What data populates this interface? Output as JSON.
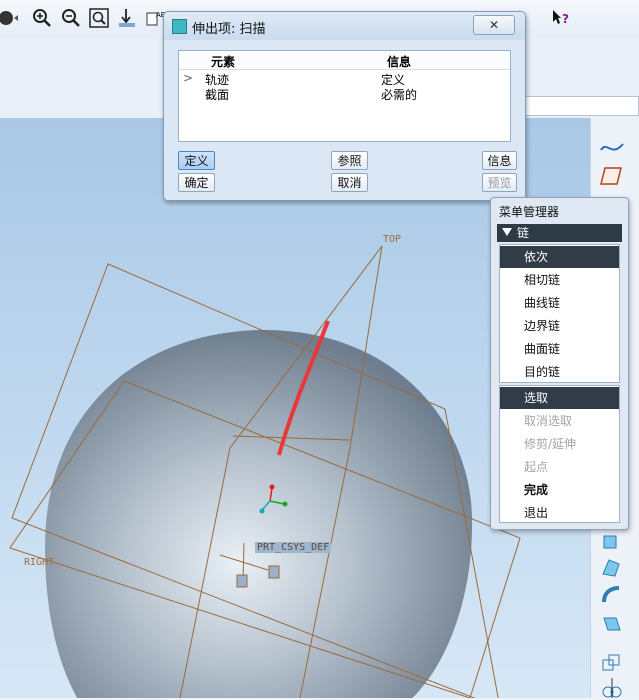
{
  "dialog": {
    "title": "伸出项: 扫描",
    "close_label": "✕",
    "columns": {
      "element": "元素",
      "info": "信息"
    },
    "rows": [
      {
        "marker": ">",
        "element": "轨迹",
        "info": "定义"
      },
      {
        "marker": "",
        "element": "截面",
        "info": "必需的"
      }
    ],
    "buttons": {
      "define": "定义",
      "reference": "参照",
      "info": "信息",
      "ok": "确定",
      "cancel": "取消",
      "preview": "预览"
    }
  },
  "menu_manager": {
    "title": "菜单管理器",
    "section": "链",
    "group1": [
      "依次",
      "相切链",
      "曲线链",
      "边界链",
      "曲面链",
      "目的链"
    ],
    "group2": [
      "选取",
      "取消选取",
      "修剪/延伸",
      "起点",
      "完成",
      "退出"
    ]
  },
  "viewport": {
    "datum_labels": {
      "top": "TOP",
      "right": "RIGHT",
      "csys": "PRT_CSYS_DEF"
    },
    "colors": {
      "background": "#b7d1ec",
      "trajectory": "#e8393a",
      "datum": "#9a6a3c"
    }
  },
  "icons": {
    "toolbar": [
      "sphere-icon",
      "zoom-in-icon",
      "zoom-out-icon",
      "refit-icon",
      "reorient-icon",
      "view-icon",
      "help-icon"
    ],
    "right_toolbar": [
      "sketch-curve-icon",
      "datum-plane-icon",
      "extrude-icon",
      "revolve-icon",
      "sweep-icon",
      "round-icon",
      "shell-icon",
      "copy-icon",
      "mirror-icon"
    ]
  }
}
